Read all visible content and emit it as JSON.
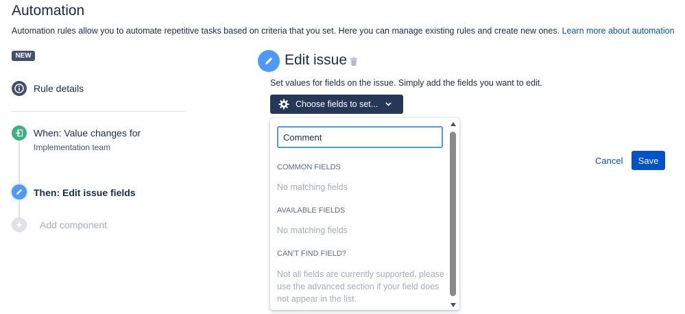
{
  "header": {
    "title": "Automation",
    "description": "Automation rules allow you to automate repetitive tasks based on criteria that you set. Here you can manage existing rules and create new ones.",
    "learn_more": "Learn more about automation"
  },
  "badge": "NEW",
  "steps": {
    "rule_details": "Rule details",
    "when_label": "When: Value changes for",
    "when_sub": "Implementation team",
    "then_label": "Then: Edit issue fields",
    "add_component": "Add component"
  },
  "editor": {
    "title": "Edit issue",
    "description": "Set values for fields on the issue. Simply add the fields you want to edit.",
    "choose_button": "Choose fields to set..."
  },
  "dropdown": {
    "search_value": "Comment",
    "common_header": "COMMON FIELDS",
    "common_text": "No matching fields",
    "available_header": "AVAILABLE FIELDS",
    "available_text": "No matching fields",
    "cant_find_header": "CAN'T FIND FIELD?",
    "cant_find_text": "Not all fields are currently supported, please use the advanced section if your field does not appear in the list."
  },
  "actions": {
    "cancel": "Cancel",
    "save": "Save"
  },
  "colors": {
    "primary": "#0052cc",
    "dark_button": "#253858",
    "step_green": "#36b37e",
    "step_blue": "#4c9aff",
    "step_gray": "#42526e"
  }
}
